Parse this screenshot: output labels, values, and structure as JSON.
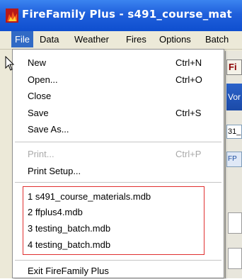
{
  "window": {
    "title": "FireFamily Plus - s491_course_mat",
    "icon": "firefamily-app-icon"
  },
  "menubar": {
    "items": [
      "File",
      "Data",
      "Weather",
      "Fires",
      "Options",
      "Batch"
    ],
    "active": "File"
  },
  "file_menu": {
    "new": {
      "label": "New",
      "shortcut": "Ctrl+N"
    },
    "open": {
      "label": "Open...",
      "shortcut": "Ctrl+O"
    },
    "close": {
      "label": "Close"
    },
    "save": {
      "label": "Save",
      "shortcut": "Ctrl+S"
    },
    "save_as": {
      "label": "Save As..."
    },
    "print": {
      "label": "Print...",
      "shortcut": "Ctrl+P",
      "disabled": true
    },
    "print_setup": {
      "label": "Print Setup..."
    },
    "recent": [
      "1 s491_course_materials.mdb",
      "2 ffplus4.mdb",
      "3 testing_batch.mdb",
      "4 testing_batch.mdb"
    ],
    "exit": {
      "label": "Exit FireFamily Plus"
    }
  },
  "background": {
    "button_label": "Fi",
    "blue_label": "Vor",
    "field_text": "31_",
    "field2_text": "FP Y"
  },
  "colors": {
    "titlebar": "#1f5fdb",
    "menu_highlight": "#316ac5",
    "recent_highlight_border": "#e03030",
    "menubar_bg": "#ece9d8"
  }
}
